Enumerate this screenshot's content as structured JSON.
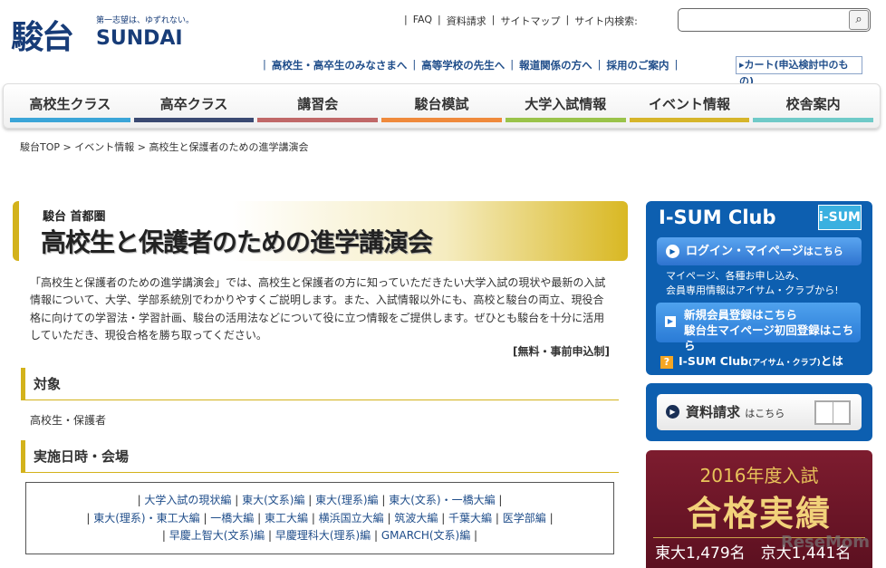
{
  "header": {
    "logo_kanji": "駿台",
    "logo_tagline": "第一志望は、ゆずれない。",
    "logo_en": "SUNDAI",
    "top_links": [
      "FAQ",
      "資料請求",
      "サイトマップ"
    ],
    "search_label": "サイト内検索:",
    "search_value": "",
    "audience_links": [
      "高校生・高卒生のみなさまへ",
      "高等学校の先生へ",
      "報道関係の方へ",
      "採用のご案内"
    ],
    "cart": "▸カート(申込検討中のもの)"
  },
  "nav": [
    {
      "label": "高校生クラス",
      "color": "#3ba5d8"
    },
    {
      "label": "高卒クラス",
      "color": "#3b4a72"
    },
    {
      "label": "講習会",
      "color": "#c06868"
    },
    {
      "label": "駿台模試",
      "color": "#ef8a3c"
    },
    {
      "label": "大学入試情報",
      "color": "#9ac34a"
    },
    {
      "label": "イベント情報",
      "color": "#d6b52a"
    },
    {
      "label": "校舎案内",
      "color": "#6fcac8"
    }
  ],
  "breadcrumb": [
    "駿台TOP",
    "イベント情報",
    "高校生と保護者のための進学講演会"
  ],
  "main": {
    "banner_sub": "駿台 首都圏",
    "banner_title": "高校生と保護者のための進学講演会",
    "intro": "「高校生と保護者のための進学講演会」では、高校生と保護者の方に知っていただきたい大学入試の現状や最新の入試情報について、大学、学部系統別でわかりやすくご説明します。また、入試情報以外にも、高校と駿台の両立、現役合格に向けての学習法・学習計画、駿台の活用法などについて役に立つ情報をご提供します。ぜひとも駿台を十分に活用していただき、現役合格を勝ち取ってください。",
    "free": "[無料・事前申込制]",
    "target_heading": "対象",
    "target_text": "高校生・保護者",
    "schedule_heading": "実施日時・会場",
    "links": [
      [
        "大学入試の現状編",
        "東大(文系)編",
        "東大(理系)編",
        "東大(文系)・一橋大編"
      ],
      [
        "東大(理系)・東工大編",
        "一橋大編",
        "東工大編",
        "横浜国立大編",
        "筑波大編",
        "千葉大編",
        "医学部編"
      ],
      [
        "早慶上智大(文系)編",
        "早慶理科大(理系)編",
        "GMARCH(文系)編"
      ]
    ]
  },
  "sidebar": {
    "club_title": "I-SUM Club",
    "club_badge": "i-SUM Club",
    "login": "ログイン・マイページ",
    "login_suffix": "はこちら",
    "desc1": "マイページ、各種お申し込み、",
    "desc2": "会員専用情報はアイサム・クラブから!",
    "reg1": "新規会員登録はこちら",
    "reg2": "駿台生マイページ初回登録はこちら",
    "about": "I-SUM Club",
    "about_small": "(アイサム・クラブ)",
    "about_suffix": "とは",
    "doc": "資料請求",
    "doc_suffix": "はこちら",
    "results_year": "2016年度入試",
    "results_title": "合格実績",
    "results": "東大1,479名　京大1,441名"
  },
  "watermark": "ReseMom"
}
